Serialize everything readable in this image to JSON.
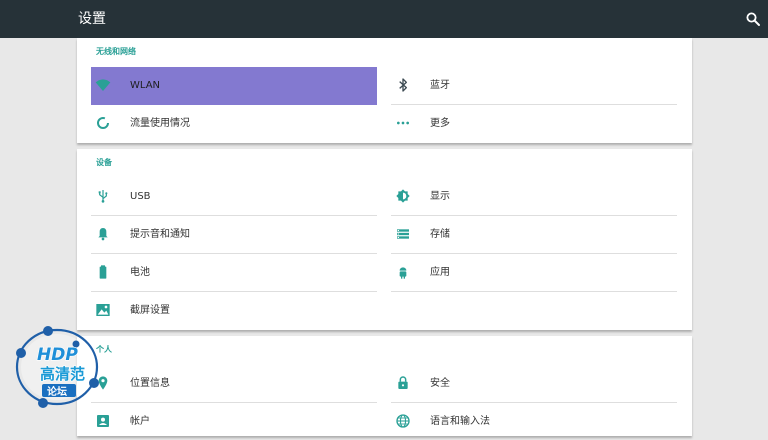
{
  "appbar": {
    "title": "设置",
    "search_icon": "search-icon"
  },
  "sections": {
    "wireless": {
      "header": "无线和网络",
      "items": [
        {
          "label": "WLAN",
          "icon": "wifi-icon",
          "selected": true
        },
        {
          "label": "蓝牙",
          "icon": "bluetooth-icon"
        },
        {
          "label": "流量使用情况",
          "icon": "data-usage-icon"
        },
        {
          "label": "更多",
          "icon": "more-icon"
        }
      ]
    },
    "device": {
      "header": "设备",
      "items": [
        {
          "label": "USB",
          "icon": "usb-icon"
        },
        {
          "label": "显示",
          "icon": "brightness-icon"
        },
        {
          "label": "提示音和通知",
          "icon": "bell-icon"
        },
        {
          "label": "存储",
          "icon": "storage-icon"
        },
        {
          "label": "电池",
          "icon": "battery-icon"
        },
        {
          "label": "应用",
          "icon": "android-icon"
        },
        {
          "label": "截屏设置",
          "icon": "screenshot-icon"
        }
      ]
    },
    "personal": {
      "header": "个人",
      "items": [
        {
          "label": "位置信息",
          "icon": "location-icon"
        },
        {
          "label": "安全",
          "icon": "lock-icon"
        },
        {
          "label": "帐户",
          "icon": "account-icon"
        },
        {
          "label": "语言和输入法",
          "icon": "globe-icon"
        }
      ]
    }
  },
  "watermark": {
    "text_top": "HDP",
    "text_mid": "高清范",
    "text_bottom": "论坛"
  },
  "colors": {
    "appbar": "#263238",
    "accent": "#2aa096",
    "selected": "#8379d0",
    "background": "#e8e8e8"
  }
}
